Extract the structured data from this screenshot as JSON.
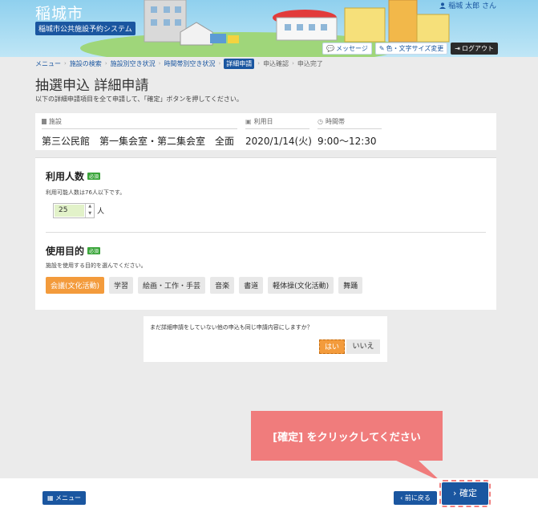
{
  "header": {
    "city_name": "稲城市",
    "system_name": "稲城市公共施設予約システム",
    "user_label": "稲城 太郎 さん",
    "message_label": "メッセージ",
    "color_font_label": "色・文字サイズ変更",
    "logout_label": "ログアウト"
  },
  "breadcrumb": {
    "items": [
      "メニュー",
      "施設の検索",
      "施設別空き状況",
      "時間帯別空き状況",
      "詳細申請",
      "申込確認",
      "申込完了"
    ]
  },
  "page": {
    "title": "抽選申込 詳細申請",
    "description": "以下の詳細申請項目を全て申請して、「確定」ボタンを押してください。"
  },
  "facility": {
    "facility_label": "施設",
    "facility_value": "第三公民館　第一集会室・第二集会室　全面",
    "date_label": "利用日",
    "date_value": "2020/1/14(火)",
    "time_label": "時間帯",
    "time_value": "9:00～12:30"
  },
  "form": {
    "required_label": "必須",
    "attendees": {
      "title": "利用人数",
      "description": "利用可能人数は76人以下です。",
      "value": "25",
      "unit": "人"
    },
    "purpose": {
      "title": "使用目的",
      "description": "施設を使用する目的を選んでください。",
      "options": [
        "会議(文化活動)",
        "学習",
        "絵画・工作・手芸",
        "音楽",
        "書道",
        "軽体操(文化活動)",
        "舞踊"
      ],
      "selected": "会議(文化活動)"
    }
  },
  "confirm_dialog": {
    "question": "まだ詳細申請をしていない他の申込も同じ申請内容にしますか？",
    "yes_label": "はい",
    "no_label": "いいえ"
  },
  "tooltip": {
    "text": "[確定] をクリックしてください"
  },
  "footer": {
    "menu_label": "メニュー",
    "back_label": "前に戻る",
    "confirm_label": "確定"
  },
  "colors": {
    "primary": "#1a56a0",
    "accent_orange": "#f39b3c",
    "tooltip_pink": "#f07c7c",
    "required_green": "#3aa53a"
  }
}
